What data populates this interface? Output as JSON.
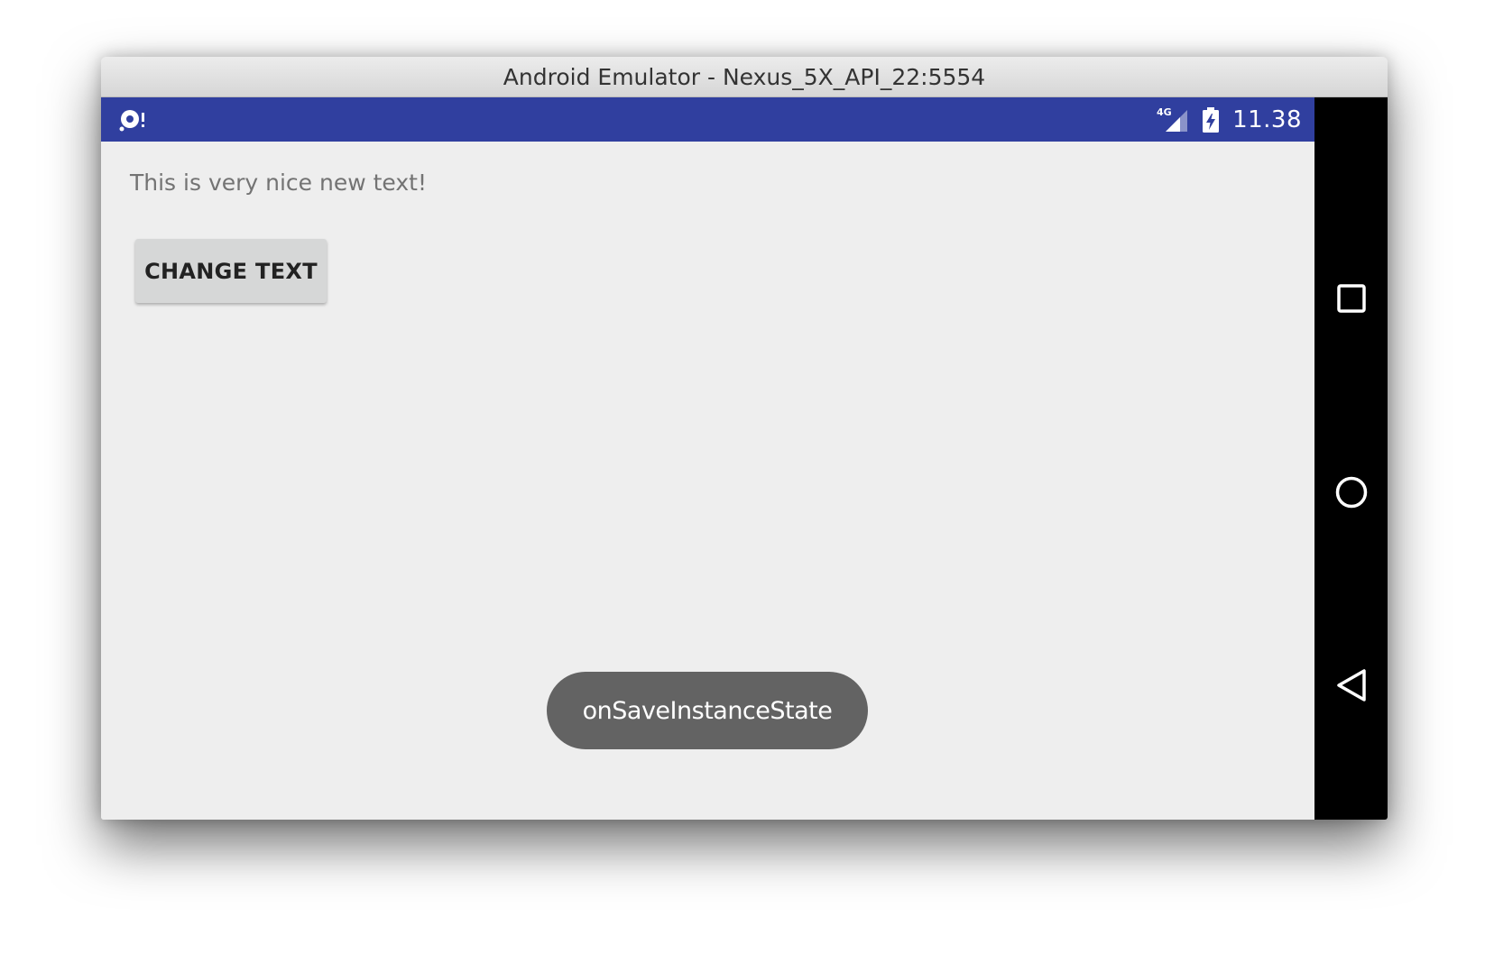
{
  "window": {
    "title": "Android Emulator - Nexus_5X_API_22:5554"
  },
  "status_bar": {
    "left_icon": "debug-icon",
    "network_label": "4G",
    "signal_icon": "signal-icon",
    "battery_icon": "battery-charging-icon",
    "time": "11.38",
    "color": "#303f9f"
  },
  "app": {
    "text": "This is very nice new text!",
    "button_label": "CHANGE TEXT"
  },
  "toast": {
    "message": "onSaveInstanceState"
  },
  "nav_bar": {
    "recents_icon": "recents-square-icon",
    "home_icon": "home-circle-icon",
    "back_icon": "back-triangle-icon"
  }
}
